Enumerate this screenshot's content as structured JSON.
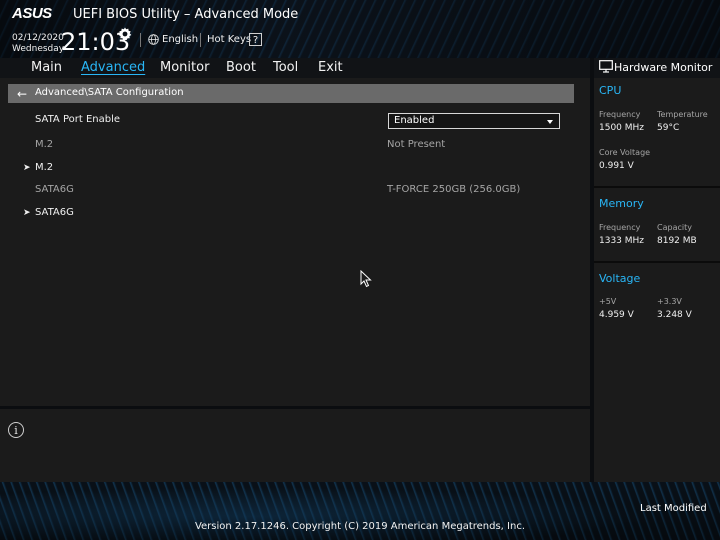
{
  "header": {
    "logo_text": "ASUS",
    "app_title": "UEFI BIOS Utility – Advanced Mode",
    "date": "02/12/2020",
    "weekday": "Wednesday",
    "time": "21:03",
    "settings_icon": "gear-icon",
    "language_icon": "globe-icon",
    "language": "English",
    "hot_keys": "Hot Keys",
    "hot_keys_key": "?"
  },
  "menu": {
    "items": [
      "Main",
      "Advanced",
      "Monitor",
      "Boot",
      "Tool",
      "Exit"
    ],
    "active": "Advanced"
  },
  "breadcrumb": {
    "icon": "arrow-left-icon",
    "path": "Advanced\\SATA Configuration"
  },
  "rows": {
    "sata_port_enable": {
      "label": "SATA Port Enable",
      "value": "Enabled"
    },
    "m2_info": {
      "label": "M.2",
      "value": "Not Present"
    },
    "m2_submenu": {
      "label": "M.2"
    },
    "sata6g_info": {
      "label": "SATA6G",
      "value": "T-FORCE 250GB (256.0GB)"
    },
    "sata6g_submenu": {
      "label": "SATA6G"
    }
  },
  "info": {
    "icon": "info-icon"
  },
  "hardware_monitor": {
    "title": "Hardware Monitor",
    "icon": "monitor-icon",
    "cpu": {
      "title": "CPU",
      "frequency_label": "Frequency",
      "frequency": "1500 MHz",
      "temperature_label": "Temperature",
      "temperature": "59°C",
      "core_voltage_label": "Core Voltage",
      "core_voltage": "0.991 V"
    },
    "memory": {
      "title": "Memory",
      "frequency_label": "Frequency",
      "frequency": "1333 MHz",
      "capacity_label": "Capacity",
      "capacity": "8192 MB"
    },
    "voltage": {
      "title": "Voltage",
      "v5_label": "+5V",
      "v5": "4.959 V",
      "v33_label": "+3.3V",
      "v33": "3.248 V"
    }
  },
  "footer": {
    "last_modified": "Last Modified",
    "version": "Version 2.17.1246. Copyright (C) 2019 American Megatrends, Inc."
  },
  "colors": {
    "accent": "#29b6f6",
    "panel": "#1b1b1b",
    "breadcrumb_bar": "#6a6a6a"
  }
}
